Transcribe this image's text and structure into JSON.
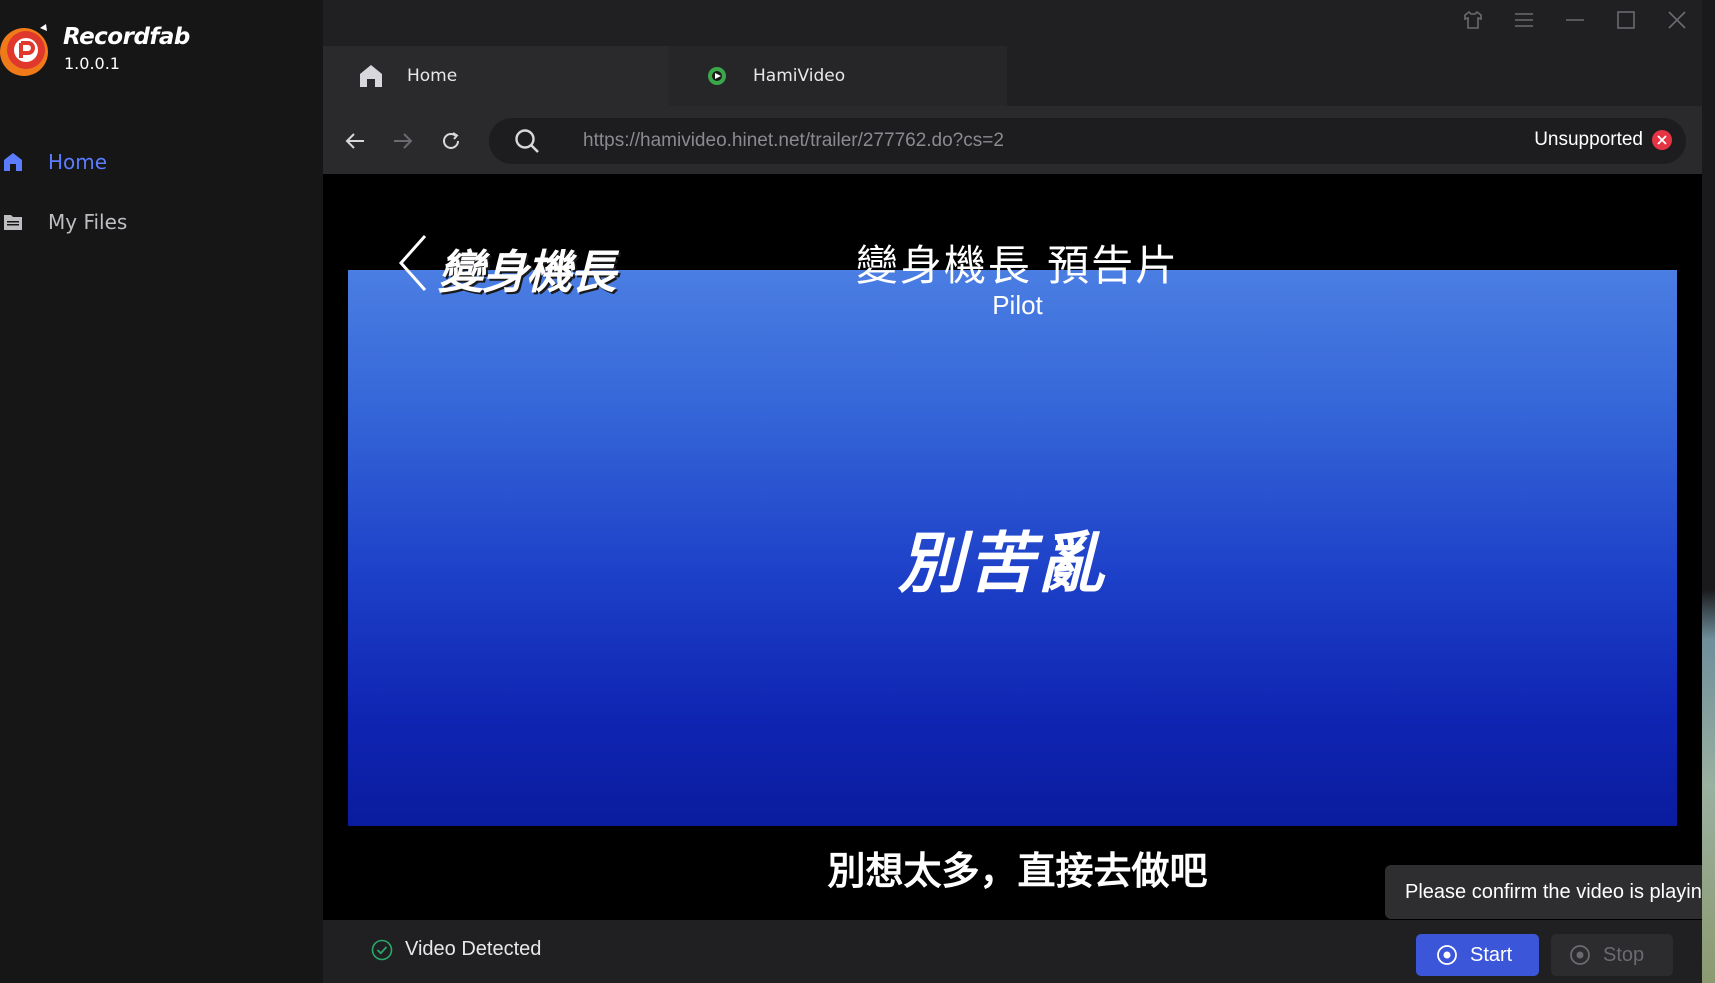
{
  "app": {
    "name": "Recordfab",
    "version": "1.0.0.1"
  },
  "sidebar": {
    "items": [
      {
        "label": "Home",
        "icon": "home-icon",
        "active": true
      },
      {
        "label": "My Files",
        "icon": "folder-icon",
        "active": false
      }
    ]
  },
  "tabs": [
    {
      "label": "Home",
      "icon": "home-icon"
    },
    {
      "label": "HamiVideo",
      "icon": "hamivideo-icon"
    }
  ],
  "navigation": {
    "url": "https://hamivideo.hinet.net/trailer/277762.do?cs=2",
    "status_text": "Unsupported",
    "status_icon": "close-circle-icon"
  },
  "video": {
    "show_logo_text": "變身機長",
    "title": "變身機長 預告片",
    "subtitle": "Pilot",
    "center_text": "別苦亂",
    "caption": "別想太多，直接去做吧"
  },
  "status": {
    "detected_text": "Video Detected"
  },
  "controls": {
    "start_label": "Start",
    "stop_label": "Stop"
  },
  "tooltip": {
    "text": "Please confirm the video is playin"
  },
  "colors": {
    "accent": "#3b56d8",
    "active_nav": "#5b7cff",
    "error": "#e53545",
    "success": "#2aa86a"
  }
}
